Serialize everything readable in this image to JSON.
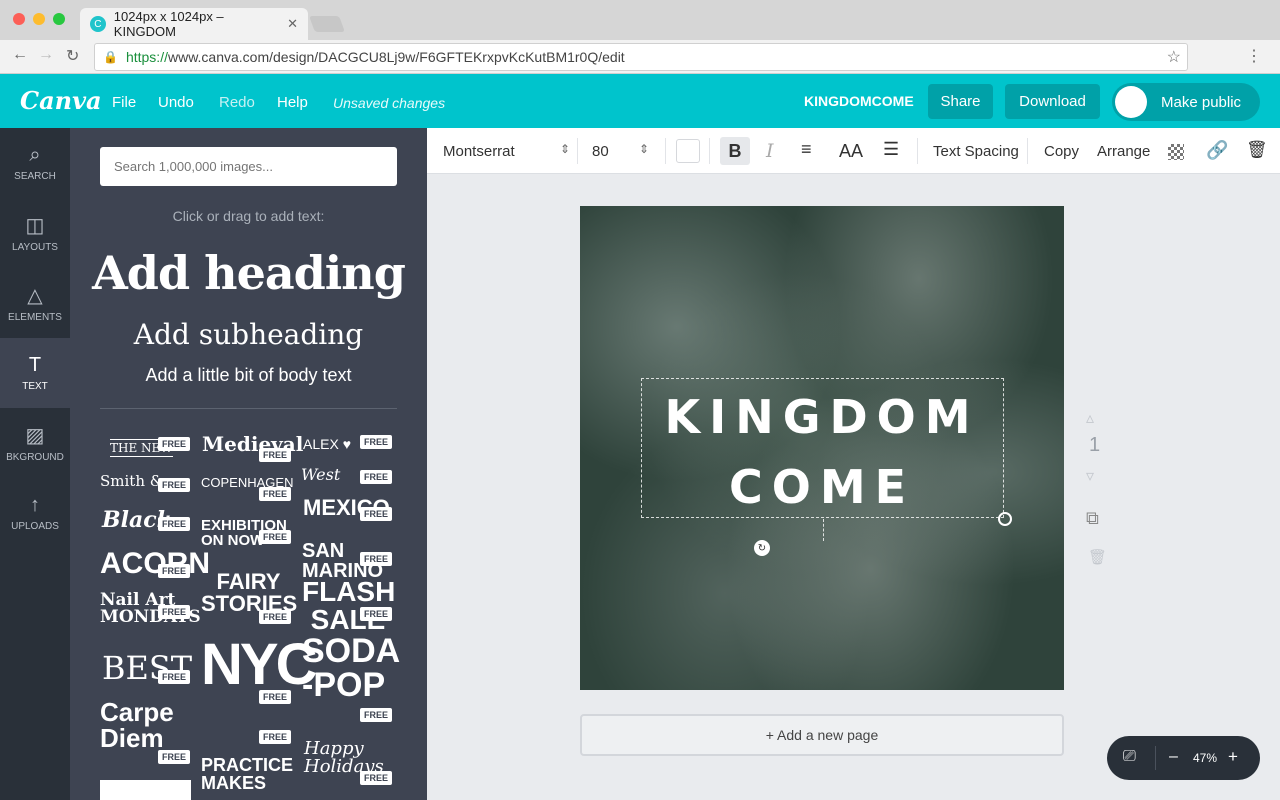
{
  "browser": {
    "tab_title": "1024px x 1024px – KINGDOM",
    "tab_close": "✕",
    "url_https": "https://",
    "url_rest": "www.canva.com/design/DACGCU8Lj9w/F6GFTEKrxpvKcKutBM1r0Q/edit"
  },
  "topbar": {
    "logo": "Canva",
    "menu": [
      "File",
      "Undo",
      "Redo",
      "Help"
    ],
    "status": "Unsaved changes",
    "doc_name": "KINGDOMCOME",
    "share_label": "Share",
    "download_label": "Download",
    "public_label": "Make public"
  },
  "leftnav": [
    {
      "label": "SEARCH",
      "icon": "search-icon"
    },
    {
      "label": "LAYOUTS",
      "icon": "layouts-icon"
    },
    {
      "label": "ELEMENTS",
      "icon": "elements-icon"
    },
    {
      "label": "TEXT",
      "icon": "text-icon"
    },
    {
      "label": "BKGROUND",
      "icon": "background-icon"
    },
    {
      "label": "UPLOADS",
      "icon": "upload-icon"
    }
  ],
  "panel": {
    "search_placeholder": "Search 1,000,000 images...",
    "hint": "Click or drag to add text:",
    "add_heading": "Add heading",
    "add_subheading": "Add subheading",
    "add_body": "Add a little bit of body text",
    "free_label": "FREE",
    "templates": [
      "THE NEW",
      "Medieval",
      "ALEX ♥",
      "Smith &",
      "COPENHAGEN",
      "West",
      "Black",
      "EXHIBITION ON NOW",
      "MEXICO",
      "ACORN",
      "FAIRY STORIES",
      "SAN MARINO",
      "Nail Art MONDAYS",
      "FLASH SALE",
      "BEST",
      "NYC",
      "SODA -POP",
      "Carpe Diem",
      "PRACTICE MAKES",
      "Happy Holidays"
    ]
  },
  "toolbar": {
    "font": "Montserrat",
    "size": "80",
    "bold": "B",
    "italic": "I",
    "case": "AA",
    "spacing": "Text Spacing",
    "copy": "Copy",
    "arrange": "Arrange"
  },
  "canvas": {
    "line1": "KINGDOM",
    "line2": "COME",
    "page_number": "1",
    "add_page": "+ Add a new page"
  },
  "zoom": {
    "minus": "–",
    "value": "47%",
    "plus": "+"
  },
  "colors": {
    "brand": "#00c4cc",
    "brand_dark": "#00a1a8",
    "sidebar": "#293039",
    "panel": "#3e4452"
  }
}
